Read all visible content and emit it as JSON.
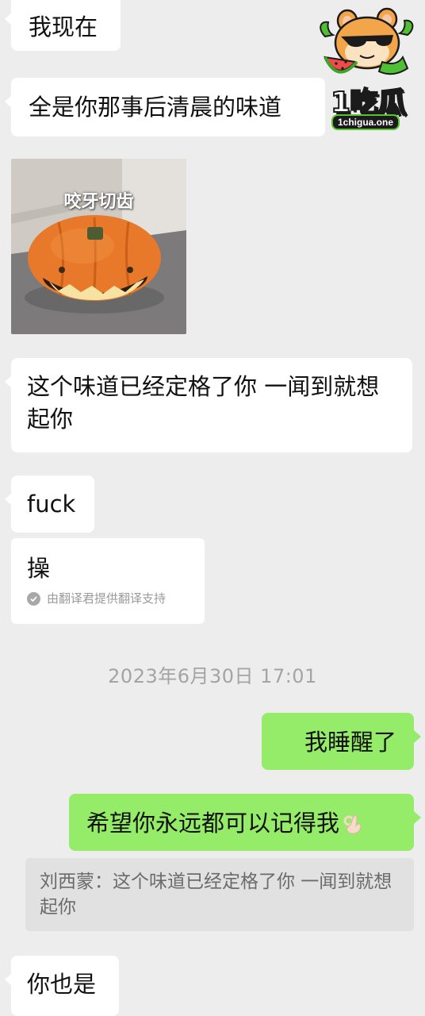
{
  "messages": {
    "m1": "我现在",
    "m2": "全是你那事后清晨的味道",
    "m3": "这个味道已经定格了你  一闻到就想起你",
    "m4": "fuck",
    "m5": "操",
    "m5_note": "由翻译君提供翻译支持",
    "m6": "我睡醒了",
    "m7": "希望你永远都可以记得我",
    "m8": "你也是"
  },
  "sticker": {
    "caption": "咬牙切齿"
  },
  "timestamp": "2023年6月30日 17:01",
  "quote": {
    "text": "刘西蒙：这个味道已经定格了你  一闻到就想起你"
  },
  "watermark": {
    "logo_text": "1吃瓜",
    "url": "1chigua.one"
  },
  "icons": {
    "translate": "check-circle-icon",
    "hand": "ok-hand-emoji-icon",
    "sticker": "pumpkin-sticker-image",
    "logo": "hamster-watermelon-logo"
  },
  "colors": {
    "background": "#ededed",
    "incoming": "#ffffff",
    "outgoing": "#95ec69",
    "quote": "#e1e1e1"
  }
}
